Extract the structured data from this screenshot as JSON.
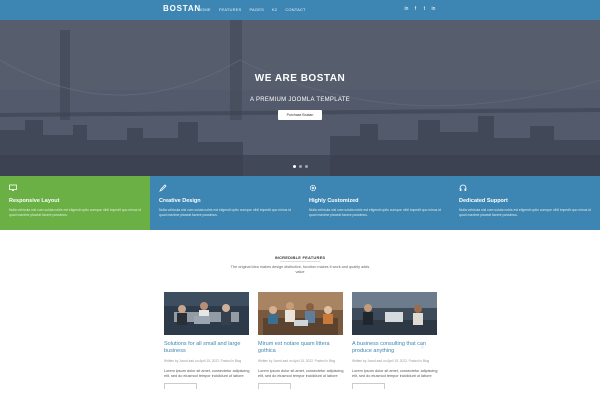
{
  "header": {
    "logo": "BOSTAN",
    "nav": [
      "HOME",
      "FEATURES",
      "PAGES",
      "K2",
      "CONTACT"
    ],
    "social_icons": [
      "linkedin-icon",
      "facebook-icon",
      "twitter-icon",
      "linkedin-icon"
    ]
  },
  "hero": {
    "title": "WE ARE BOSTAN",
    "subtitle": "A PREMIUM JOOMLA TEMPLATE",
    "button": "Purchase Bostan",
    "slide_count": 3,
    "active_slide": 1
  },
  "features": [
    {
      "icon": "monitor-icon",
      "title": "Responsive Layout",
      "text": "Nulla vehicula nisi cum soluta nobis est eligendi optio cumque nihil impedit quo minus id quod maxime placeat facere possimus.",
      "color": "#6ab045"
    },
    {
      "icon": "pencil-icon",
      "title": "Creative Design",
      "text": "Nulla vehicula nisi cum soluta nobis est eligendi optio cumque nihil impedit quo minus id quod maxime placeat facere possimus.",
      "color": "#3d86b3"
    },
    {
      "icon": "gear-icon",
      "title": "Highly Customized",
      "text": "Nulla vehicula nisi cum soluta nobis est eligendi optio cumque nihil impedit quo minus id quod maxime placeat facere possimus.",
      "color": "#3d86b3"
    },
    {
      "icon": "headphones-icon",
      "title": "Dedicated Support",
      "text": "Nulla vehicula nisi cum soluta nobis est eligendi optio cumque nihil impedit quo minus id quod maxime placeat facere possimus.",
      "color": "#3d86b3"
    }
  ],
  "section": {
    "title": "INCREDIBLE FEATURES",
    "description": "The original idea makes design distinctive, function makes it work and quality adds value"
  },
  "cards": [
    {
      "title": "Solutions for all small and large business",
      "meta": "Written by JoomLead on April 15, 2022. Posted in Blog",
      "text": "Lorem ipsum dolor sit amet, consectetur adipiscing elit, sed do eiusmod tempor incididunt ut labore"
    },
    {
      "title": "Mirum est notare quam littera gothica",
      "meta": "Written by JoomLead on April 15, 2022. Posted in Blog",
      "text": "Lorem ipsum dolor sit amet, consectetur adipiscing elit, sed do eiusmod tempor incididunt ut labore"
    },
    {
      "title": "A business consulting that can produce anything",
      "meta": "Written by JoomLead on April 15, 2022. Posted in Blog",
      "text": "Lorem ipsum dolor sit amet, consectetur adipiscing elit, sed do eiusmod tempor incididunt ut labore"
    }
  ],
  "colors": {
    "primary": "#3d86b3",
    "green": "#6ab045"
  }
}
